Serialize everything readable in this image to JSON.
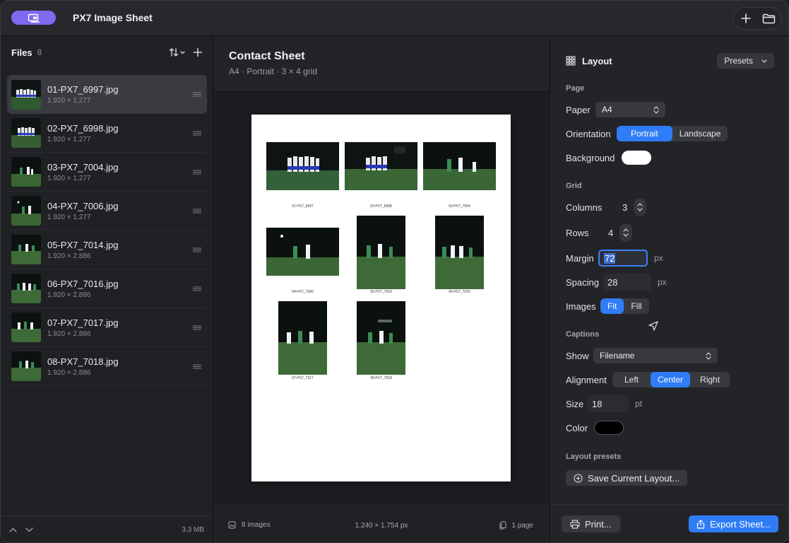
{
  "app": {
    "title": "PX7 Image Sheet",
    "badge_icon": "photo-stack-icon",
    "accent": "#7e6af0"
  },
  "titlebar": {
    "add_icon": "plus-icon",
    "folder_icon": "folder-icon"
  },
  "sidebar": {
    "title": "Files",
    "count": "8",
    "sort_icon": "sort-icon",
    "add_icon": "plus-icon",
    "selected_index": 0,
    "files": [
      {
        "name": "01-PX7_6997.jpg",
        "dims": "1.920 × 1.277"
      },
      {
        "name": "02-PX7_6998.jpg",
        "dims": "1.920 × 1.277"
      },
      {
        "name": "03-PX7_7004.jpg",
        "dims": "1.920 × 1.277"
      },
      {
        "name": "04-PX7_7006.jpg",
        "dims": "1.920 × 1.277"
      },
      {
        "name": "05-PX7_7014.jpg",
        "dims": "1.920 × 2.886"
      },
      {
        "name": "06-PX7_7016.jpg",
        "dims": "1.920 × 2.886"
      },
      {
        "name": "07-PX7_7017.jpg",
        "dims": "1.920 × 2.886"
      },
      {
        "name": "08-PX7_7018.jpg",
        "dims": "1.920 × 2.886"
      }
    ],
    "footer": {
      "total_size": "3,3 MB"
    }
  },
  "sheet": {
    "title": "Contact Sheet",
    "subtitle": "A4 · Portrait · 3 × 4 grid",
    "captions": [
      "01-PX7_6997",
      "02-PX7_6998",
      "03-PX7_7004",
      "04-PX7_7006",
      "05-PX7_7014",
      "06-PX7_7016",
      "07-PX7_7017",
      "08-PX7_7018"
    ],
    "footer": {
      "images": "8 images",
      "dimensions": "1.240 × 1.754 px",
      "pages": "1 page"
    }
  },
  "layout": {
    "title": "Layout",
    "presets_label": "Presets",
    "page": {
      "section": "Page",
      "paper_label": "Paper",
      "paper_value": "A4",
      "orientation_label": "Orientation",
      "orientation_options": [
        "Portrait",
        "Landscape"
      ],
      "orientation_selected": "Portrait",
      "background_label": "Background",
      "background_color": "#ffffff"
    },
    "grid": {
      "section": "Grid",
      "columns_label": "Columns",
      "columns_value": "3",
      "rows_label": "Rows",
      "rows_value": "4",
      "margin_label": "Margin",
      "margin_value": "72",
      "margin_unit": "px",
      "spacing_label": "Spacing",
      "spacing_value": "28",
      "spacing_unit": "px",
      "images_label": "Images",
      "images_options": [
        "Fit",
        "Fill"
      ],
      "images_selected": "Fit"
    },
    "captions": {
      "section": "Captions",
      "show_label": "Show",
      "show_value": "Filename",
      "alignment_label": "Alignment",
      "alignment_options": [
        "Left",
        "Center",
        "Right"
      ],
      "alignment_selected": "Center",
      "size_label": "Size",
      "size_value": "18",
      "size_unit": "pt",
      "color_label": "Color",
      "color_value": "#000000"
    },
    "presets": {
      "section": "Layout presets",
      "save_label": "Save Current Layout..."
    },
    "footer": {
      "print_label": "Print...",
      "export_label": "Export Sheet..."
    }
  }
}
